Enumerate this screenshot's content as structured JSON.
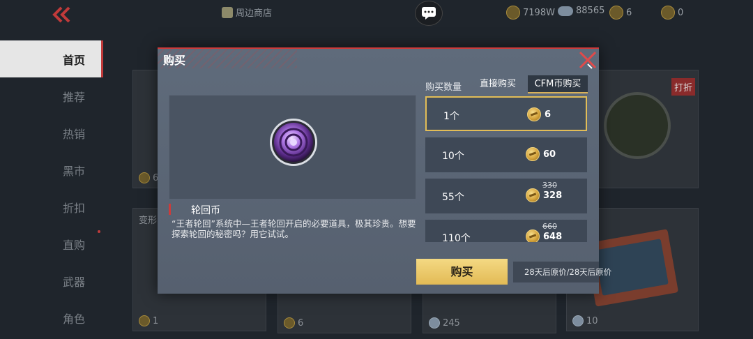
{
  "topbar": {
    "nearby_store": "周边商店",
    "resources": [
      {
        "icon": "gold-coin-icon",
        "value": "7198W"
      },
      {
        "icon": "cloud-currency-icon",
        "value": "88565"
      },
      {
        "icon": "cfm-coin-icon",
        "value": "6"
      },
      {
        "icon": "cfm-point-icon",
        "value": "0"
      }
    ]
  },
  "sidebar": {
    "items": [
      {
        "label": "首页",
        "active": true
      },
      {
        "label": "推荐"
      },
      {
        "label": "热销"
      },
      {
        "label": "黑市"
      },
      {
        "label": "折扣"
      },
      {
        "label": "直购"
      },
      {
        "label": "武器"
      },
      {
        "label": "角色"
      }
    ]
  },
  "background": {
    "discount_badge": "打折",
    "card_values": [
      "6",
      "1",
      "6",
      "245",
      "10"
    ],
    "partial_labels": [
      "变形"
    ]
  },
  "modal": {
    "title": "购买",
    "item_name": "轮回币",
    "item_desc": "“王者轮回”系统中—王者轮回开启的必要道具，极其珍贵。想要探索轮回的秘密吗？用它试试。",
    "qty_label": "购买数量",
    "tabs": {
      "direct": "直接购买",
      "cfm": "CFM币购买"
    },
    "options": [
      {
        "qty": "1个",
        "price": "6",
        "selected": true
      },
      {
        "qty": "10个",
        "price": "60"
      },
      {
        "qty": "55个",
        "price": "328",
        "old_price": "330"
      },
      {
        "qty": "110个",
        "price": "648",
        "old_price": "660"
      }
    ],
    "buy_label": "购买",
    "restore_note": "28天后原价/28天后原价"
  },
  "colors": {
    "accent_red": "#cc3b3b",
    "gold": "#e2bd57",
    "panel": "#5f6b7b"
  }
}
